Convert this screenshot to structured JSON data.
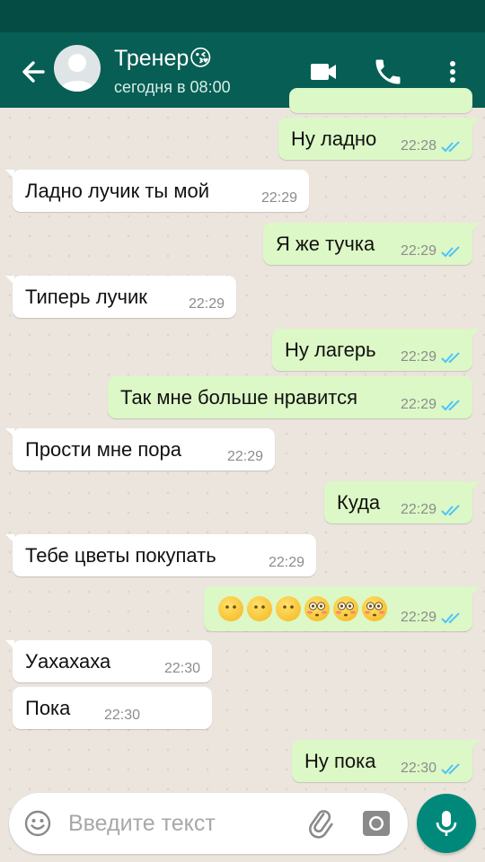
{
  "header": {
    "contact_name": "Тренер",
    "contact_emoji": "😘",
    "last_seen": "сегодня в 08:00"
  },
  "messages": [
    {
      "dir": "out",
      "text": "Ну ладно",
      "time": "22:28"
    },
    {
      "dir": "in",
      "text": "Ладно лучик ты мой",
      "time": "22:29"
    },
    {
      "dir": "out",
      "text": "Я же тучка",
      "time": "22:29"
    },
    {
      "dir": "in",
      "text": "Типерь лучик",
      "time": "22:29"
    },
    {
      "dir": "out",
      "text": "Ну лагерь",
      "time": "22:29"
    },
    {
      "dir": "out",
      "text": "Так мне больше нравится",
      "time": "22:29"
    },
    {
      "dir": "in",
      "text": "Прости мне пора",
      "time": "22:29"
    },
    {
      "dir": "out",
      "text": "Куда",
      "time": "22:29"
    },
    {
      "dir": "in",
      "text": "Тебе цветы покупать",
      "time": "22:29"
    },
    {
      "dir": "out",
      "emojis": [
        "neutral-face",
        "neutral-face",
        "neutral-face",
        "flushed-face",
        "flushed-face",
        "flushed-face"
      ],
      "time": "22:29"
    },
    {
      "dir": "in",
      "text": "Уахахаха",
      "time": "22:30"
    },
    {
      "dir": "in",
      "text": "Пока",
      "time": "22:30"
    },
    {
      "dir": "out",
      "text": "Ну пока",
      "time": "22:30"
    }
  ],
  "composer": {
    "placeholder": "Введите текст"
  },
  "icons": {
    "back": "arrow-left-icon",
    "video": "video-camera-icon",
    "call": "phone-icon",
    "menu": "more-vert-icon",
    "emoji": "smiley-icon",
    "attach": "paperclip-icon",
    "camera": "camera-icon",
    "mic": "microphone-icon"
  },
  "colors": {
    "header": "#075e54",
    "status_bar": "#054d44",
    "outgoing_bubble": "#dcf8c6",
    "incoming_bubble": "#ffffff",
    "read_ticks": "#4fc3f7",
    "mic_button": "#00897b"
  }
}
